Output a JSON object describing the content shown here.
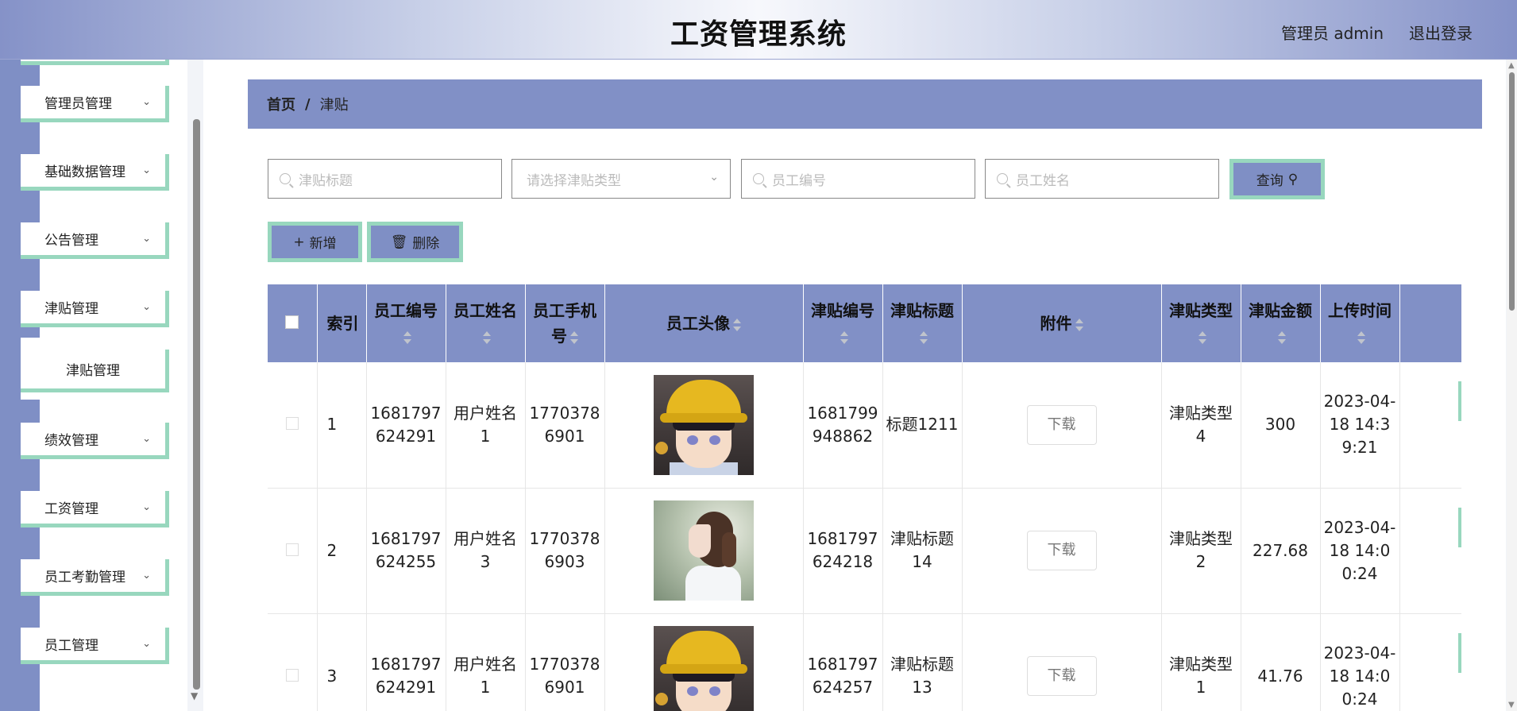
{
  "header": {
    "title": "工资管理系统",
    "user_label": "管理员 admin",
    "logout_label": "退出登录"
  },
  "sidebar": {
    "items": [
      {
        "label": "管理员管理"
      },
      {
        "label": "基础数据管理"
      },
      {
        "label": "公告管理"
      },
      {
        "label": "津贴管理"
      },
      {
        "label": "绩效管理"
      },
      {
        "label": "工资管理"
      },
      {
        "label": "员工考勤管理"
      },
      {
        "label": "员工管理"
      }
    ],
    "active_submenu": "津贴管理"
  },
  "breadcrumb": {
    "home": "首页",
    "separator": "/",
    "current": "津贴"
  },
  "filters": {
    "title_placeholder": "津贴标题",
    "type_placeholder": "请选择津贴类型",
    "emp_no_placeholder": "员工编号",
    "emp_name_placeholder": "员工姓名",
    "query_label": "查询"
  },
  "actions": {
    "add_label": "新增",
    "delete_label": "删除"
  },
  "table": {
    "columns": [
      {
        "label": "索引"
      },
      {
        "label": "员工编号"
      },
      {
        "label": "员工姓名"
      },
      {
        "label": "员工手机号"
      },
      {
        "label": "员工头像"
      },
      {
        "label": "津贴编号"
      },
      {
        "label": "津贴标题"
      },
      {
        "label": "附件"
      },
      {
        "label": "津贴类型"
      },
      {
        "label": "津贴金额"
      },
      {
        "label": "上传时间"
      }
    ],
    "download_label": "下载",
    "rows": [
      {
        "index": "1",
        "emp_no": "1681797624291",
        "emp_name": "用户姓名1",
        "phone": "17703786901",
        "avatar": "boy-avatar",
        "allowance_no": "1681799948862",
        "title": "标题1211",
        "type": "津贴类型4",
        "amount": "300",
        "time": "2023-04-18 14:39:21"
      },
      {
        "index": "2",
        "emp_no": "1681797624255",
        "emp_name": "用户姓名3",
        "phone": "17703786903",
        "avatar": "girl-avatar",
        "allowance_no": "1681797624218",
        "title": "津贴标题14",
        "type": "津贴类型2",
        "amount": "227.68",
        "time": "2023-04-18 14:00:24"
      },
      {
        "index": "3",
        "emp_no": "1681797624291",
        "emp_name": "用户姓名1",
        "phone": "17703786901",
        "avatar": "boy-avatar",
        "allowance_no": "1681797624257",
        "title": "津贴标题13",
        "type": "津贴类型1",
        "amount": "41.76",
        "time": "2023-04-18 14:00:24"
      }
    ]
  },
  "colors": {
    "accent": "#7f8fc5",
    "accent_border": "#98d7be"
  }
}
